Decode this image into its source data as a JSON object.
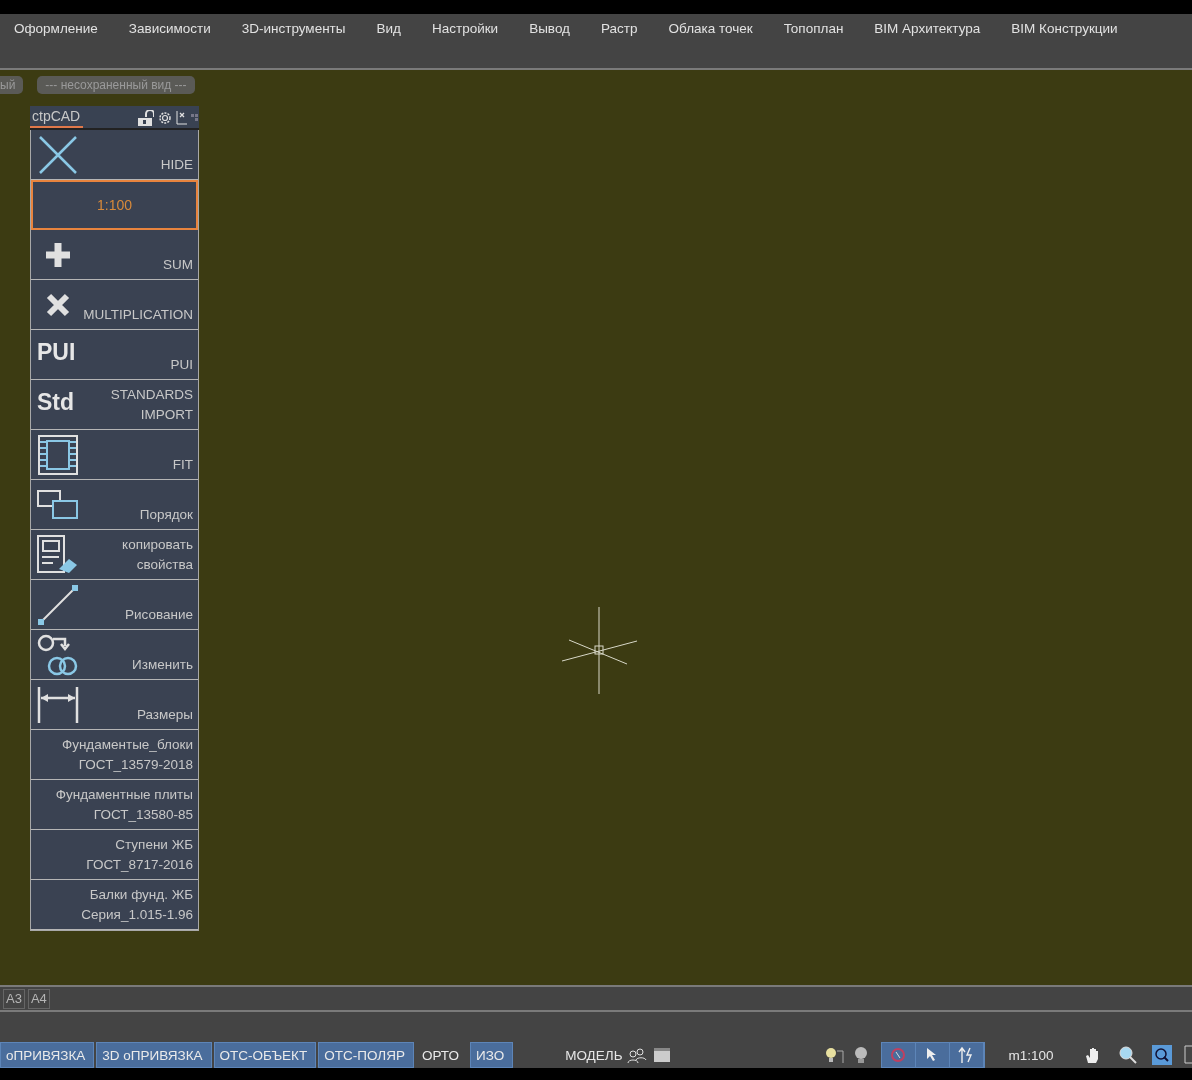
{
  "menu": [
    "Оформление",
    "Зависимости",
    "3D-инструменты",
    "Вид",
    "Настройки",
    "Вывод",
    "Растр",
    "Облака точек",
    "Топоплан",
    "BIM Архитектура",
    "BIM Конструкции"
  ],
  "view_tabs": [
    {
      "label": "ый"
    },
    {
      "label": "--- несохраненный вид ---"
    }
  ],
  "panel": {
    "title": "ctpCAD",
    "items": [
      {
        "kind": "icon",
        "label": "HIDE",
        "selected": false
      },
      {
        "kind": "scale",
        "label": "1:100",
        "selected": true
      },
      {
        "kind": "icon",
        "label": "SUM",
        "selected": false
      },
      {
        "kind": "icon",
        "label": "MULTIPLICATION",
        "selected": false
      },
      {
        "kind": "glyph",
        "glyph": "PUI",
        "label": "PUI",
        "selected": false
      },
      {
        "kind": "glyph",
        "glyph": "Std",
        "label": "STANDARDS IMPORT",
        "selected": false
      },
      {
        "kind": "icon",
        "label": "FIT",
        "selected": false
      },
      {
        "kind": "icon",
        "label": "Порядок",
        "selected": false
      },
      {
        "kind": "icon",
        "label": "копировать свойства",
        "selected": false
      },
      {
        "kind": "icon",
        "label": "Рисование",
        "selected": false
      },
      {
        "kind": "icon",
        "label": "Изменить",
        "selected": false
      },
      {
        "kind": "icon",
        "label": "Размеры",
        "selected": false
      },
      {
        "kind": "text",
        "label": "Фундаментые_блоки ГОСТ_13579-2018",
        "selected": false
      },
      {
        "kind": "text",
        "label": "Фундаментные плиты ГОСТ_13580-85",
        "selected": false
      },
      {
        "kind": "text",
        "label": "Ступени ЖБ ГОСТ_8717-2016",
        "selected": false
      },
      {
        "kind": "text",
        "label": "Балки фунд. ЖБ Серия_1.015-1.96",
        "selected": false
      }
    ]
  },
  "layout_tabs": [
    {
      "label": "A3"
    },
    {
      "label": "A4"
    }
  ],
  "status_bar": {
    "toggles": [
      {
        "label": "оПРИВЯЗКА",
        "on": true
      },
      {
        "label": "3D оПРИВЯЗКА",
        "on": true
      },
      {
        "label": "ОТС-ОБЪЕКТ",
        "on": true
      },
      {
        "label": "ОТС-ПОЛЯР",
        "on": true
      },
      {
        "label": "ОРТО",
        "on": false
      },
      {
        "label": "ИЗО",
        "on": true
      }
    ],
    "space": "МОДЕЛЬ",
    "scale": "m1:100"
  }
}
